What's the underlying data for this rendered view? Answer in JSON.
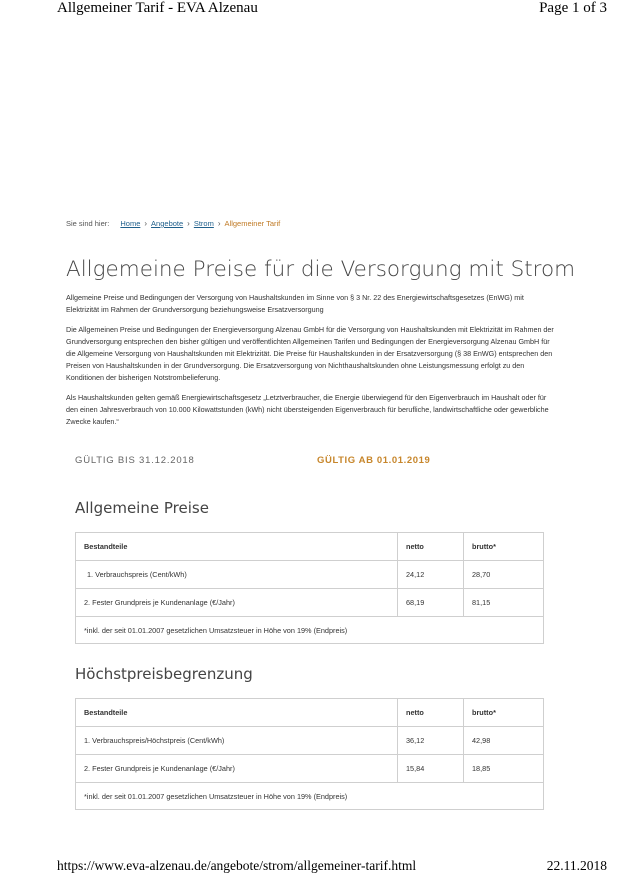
{
  "print_header": {
    "left": "Allgemeiner Tarif - EVA Alzenau",
    "right": "Page 1 of 3"
  },
  "breadcrumb": {
    "prefix": "Sie sind hier:",
    "items": [
      "Home",
      "Angebote",
      "Strom"
    ],
    "separator": "›",
    "current": "Allgemeiner Tarif"
  },
  "page_title": "Allgemeine Preise für die Versorgung mit Strom",
  "paragraphs": [
    "Allgemeine Preise und Bedingungen der Versorgung von Haushaltskunden im Sinne von § 3 Nr. 22 des Energiewirtschaftsgesetzes (EnWG) mit Elektrizität im Rahmen der Grundversorgung beziehungsweise Ersatzversorgung",
    "Die Allgemeinen Preise und Bedingungen der Energieversorgung Alzenau GmbH für die Versorgung von Haushaltskunden mit Elektrizität im Rahmen der Grundversorgung entsprechen den bisher gültigen und veröffentlichten Allgemeinen Tarifen und Bedingungen der Energieversorgung Alzenau GmbH für die Allgemeine Versorgung von Haushaltskunden mit Elektrizität. Die Preise für Haushaltskunden in der Ersatzversorgung (§ 38 EnWG) entsprechen den Preisen von Haushaltskunden in der Grundversorgung. Die Ersatzversorgung von Nichthaushaltskunden ohne Leistungsmessung erfolgt zu den Konditionen der bisherigen Notstrombelieferung.",
    "Als Haushaltskunden gelten gemäß Energiewirtschaftsgesetz „Letztverbraucher, die Energie überwiegend für den Eigenverbrauch im Haushalt oder für den einen Jahresverbrauch von 10.000 Kilowattstunden (kWh) nicht übersteigenden Eigenverbrauch für berufliche, landwirtschaftliche oder gewerbliche Zwecke kaufen.“"
  ],
  "tabs": {
    "old": "GÜLTIG BIS 31.12.2018",
    "new": "GÜLTIG AB 01.01.2019"
  },
  "sections": [
    {
      "title": "Allgemeine Preise",
      "headers": [
        "Bestandteile",
        "netto",
        "brutto*"
      ],
      "rows": [
        [
          "1. Verbrauchspreis (Cent/kWh)",
          "24,12",
          "28,70"
        ],
        [
          "2. Fester Grundpreis je Kundenanlage (€/Jahr)",
          "68,19",
          "81,15"
        ]
      ],
      "note": "*inkl. der seit 01.01.2007 gesetzlichen Umsatzsteuer in Höhe von 19% (Endpreis)"
    },
    {
      "title": "Höchstpreisbegrenzung",
      "headers": [
        "Bestandteile",
        "netto",
        "brutto*"
      ],
      "rows": [
        [
          "1. Verbrauchspreis/Höchstpreis (Cent/kWh)",
          "36,12",
          "42,98"
        ],
        [
          "2. Fester Grundpreis je Kundenanlage (€/Jahr)",
          "15,84",
          "18,85"
        ]
      ],
      "note": "*inkl. der seit 01.01.2007 gesetzlichen Umsatzsteuer in Höhe von 19% (Endpreis)"
    }
  ],
  "print_footer": {
    "url": "https://www.eva-alzenau.de/angebote/strom/allgemeiner-tarif.html",
    "date": "22.11.2018"
  }
}
